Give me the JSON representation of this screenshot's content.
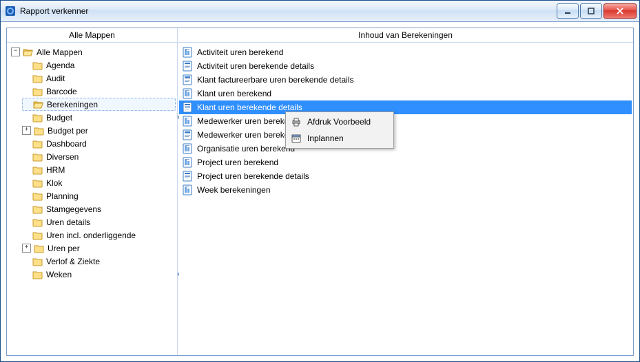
{
  "window": {
    "title": "Rapport verkenner"
  },
  "left": {
    "header": "Alle Mappen",
    "root_label": "Alle Mappen",
    "items": [
      {
        "label": "Agenda"
      },
      {
        "label": "Audit"
      },
      {
        "label": "Barcode"
      },
      {
        "label": "Berekeningen"
      },
      {
        "label": "Budget"
      },
      {
        "label": "Budget per"
      },
      {
        "label": "Dashboard"
      },
      {
        "label": "Diversen"
      },
      {
        "label": "HRM"
      },
      {
        "label": "Klok"
      },
      {
        "label": "Planning"
      },
      {
        "label": "Stamgegevens"
      },
      {
        "label": "Uren details"
      },
      {
        "label": "Uren incl. onderliggende"
      },
      {
        "label": "Uren per"
      },
      {
        "label": "Verlof & Ziekte"
      },
      {
        "label": "Weken"
      }
    ]
  },
  "right": {
    "header": "Inhoud van Berekeningen",
    "items": [
      {
        "label": "Activiteit uren berekend"
      },
      {
        "label": "Activiteit uren berekende details"
      },
      {
        "label": "Klant factureerbare uren berekende details"
      },
      {
        "label": "Klant uren berekend"
      },
      {
        "label": "Klant uren berekende details"
      },
      {
        "label": "Medewerker uren berekend"
      },
      {
        "label": "Medewerker uren berekende details"
      },
      {
        "label": "Organisatie uren berekend"
      },
      {
        "label": "Project uren berekend"
      },
      {
        "label": "Project uren berekende details"
      },
      {
        "label": "Week berekeningen"
      }
    ]
  },
  "context_menu": {
    "items": [
      {
        "label": "Afdruk Voorbeeld"
      },
      {
        "label": "Inplannen"
      }
    ]
  }
}
